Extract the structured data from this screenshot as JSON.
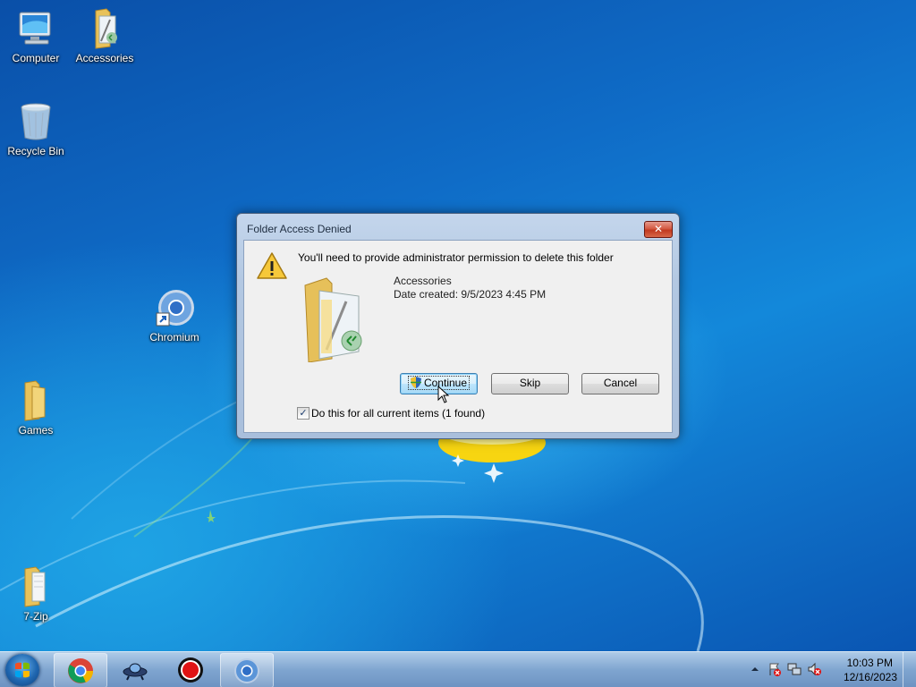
{
  "desktop": {
    "icons": [
      {
        "name": "Computer",
        "icon": "computer-icon"
      },
      {
        "name": "Accessories",
        "icon": "folder-icon"
      },
      {
        "name": "Recycle Bin",
        "icon": "recycle-bin-icon"
      },
      {
        "name": "Chromium",
        "icon": "chromium-icon"
      },
      {
        "name": "Games",
        "icon": "folder-icon"
      },
      {
        "name": "7-Zip",
        "icon": "folder-icon"
      }
    ]
  },
  "dialog": {
    "title": "Folder Access Denied",
    "close_label": "✕",
    "message": "You'll need to provide administrator permission to delete this folder",
    "item_name": "Accessories",
    "item_date": "Date created: 9/5/2023 4:45 PM",
    "continue_label": "Continue",
    "skip_label": "Skip",
    "cancel_label": "Cancel",
    "checkbox_label": "Do this for all current items (1 found)",
    "checkbox_checked": true
  },
  "taskbar": {
    "pinned": [
      "chrome-icon",
      "ufo-icon",
      "record-icon",
      "chromium-icon"
    ],
    "tray_icons": [
      "show-hidden-icons-arrow",
      "action-center-flag-icon",
      "network-icon",
      "volume-muted-icon"
    ],
    "clock_time": "10:03 PM",
    "clock_date": "12/16/2023"
  },
  "colors": {
    "desktop_blue": "#0f6cc7",
    "dialog_frame": "#b3c8e2",
    "close_red": "#c13a20",
    "continue_highlight": "#bee6fd"
  }
}
